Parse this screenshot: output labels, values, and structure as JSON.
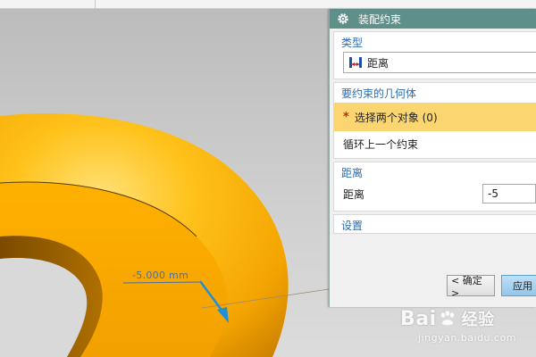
{
  "viewport": {
    "dimension_label": "-5.000 mm",
    "colors": {
      "torus": "#ffb400",
      "torus_dark": "#c07a00",
      "background": "#c8c8c8",
      "dimension": "#4a6ea0",
      "vector": "#1f8fd8"
    }
  },
  "dialog": {
    "title": "装配约束",
    "title_icon": "gear-icon",
    "colors": {
      "title_bar": "#5f8f89",
      "section_head": "#2a6db3",
      "highlight": "#fbd570"
    },
    "type_section": {
      "header": "类型",
      "selected_type": "距离",
      "type_icon": "distance-constraint-icon"
    },
    "geometry_section": {
      "header": "要约束的几何体",
      "select_prompt": "选择两个对象 (0)",
      "cycle_label": "循环上一个约束"
    },
    "distance_section": {
      "header": "距离",
      "field_label": "距离",
      "field_value": "-5"
    },
    "settings_section": {
      "header": "设置"
    },
    "buttons": {
      "ok": "< 确定 >",
      "apply": "应用"
    }
  },
  "watermark": {
    "brand_left": "Bai",
    "brand_right": "经验",
    "url": "jingyan.baidu.com"
  }
}
